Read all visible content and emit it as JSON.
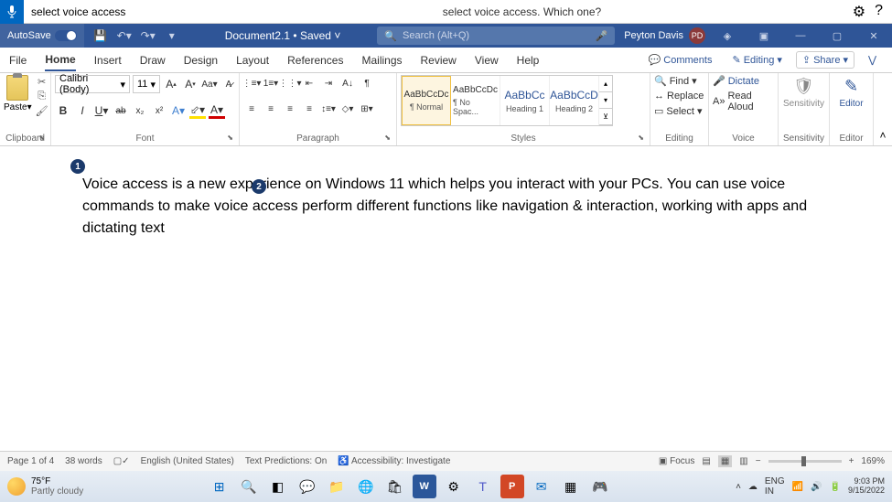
{
  "voice_access": {
    "input_text": "select voice access",
    "prompt": "select voice access. Which one?"
  },
  "title": {
    "autosave": "AutoSave",
    "doc": "Document2.1 • Saved",
    "search_placeholder": "Search (Alt+Q)",
    "user": "Peyton Davis",
    "initials": "PD"
  },
  "tabs": {
    "items": [
      "File",
      "Home",
      "Insert",
      "Draw",
      "Design",
      "Layout",
      "References",
      "Mailings",
      "Review",
      "View",
      "Help"
    ],
    "comments": "Comments",
    "editing": "Editing",
    "share": "Share"
  },
  "ribbon": {
    "clipboard": {
      "paste": "Paste",
      "label": "Clipboard"
    },
    "font": {
      "name": "Calibri (Body)",
      "size": "11",
      "label": "Font"
    },
    "paragraph": {
      "label": "Paragraph"
    },
    "styles": {
      "label": "Styles",
      "items": [
        {
          "preview": "AaBbCcDc",
          "name": "¶ Normal"
        },
        {
          "preview": "AaBbCcDc",
          "name": "¶ No Spac..."
        },
        {
          "preview": "AaBbCc",
          "name": "Heading 1"
        },
        {
          "preview": "AaBbCcD",
          "name": "Heading 2"
        }
      ]
    },
    "editing": {
      "find": "Find",
      "replace": "Replace",
      "select": "Select",
      "label": "Editing"
    },
    "voice": {
      "dictate": "Dictate",
      "read": "Read Aloud",
      "label": "Voice"
    },
    "sensitivity": {
      "btn": "Sensitivity",
      "label": "Sensitivity"
    },
    "editor": {
      "btn": "Editor",
      "label": "Editor"
    }
  },
  "document": {
    "body": "Voice access is a new experience on Windows 11 which helps you interact with your PCs. You can use voice commands to make voice access perform different functions like navigation & interaction, working with apps and dictating text",
    "badges": {
      "b1": "1",
      "b2": "2"
    }
  },
  "status": {
    "page": "Page 1 of 4",
    "words": "38 words",
    "lang": "English (United States)",
    "predictions": "Text Predictions: On",
    "accessibility": "Accessibility: Investigate",
    "focus": "Focus",
    "zoom": "169%"
  },
  "taskbar": {
    "temp": "75°F",
    "weather": "Partly cloudy",
    "lang": "ENG",
    "region": "IN",
    "time": "9:03 PM",
    "date": "9/15/2022"
  }
}
